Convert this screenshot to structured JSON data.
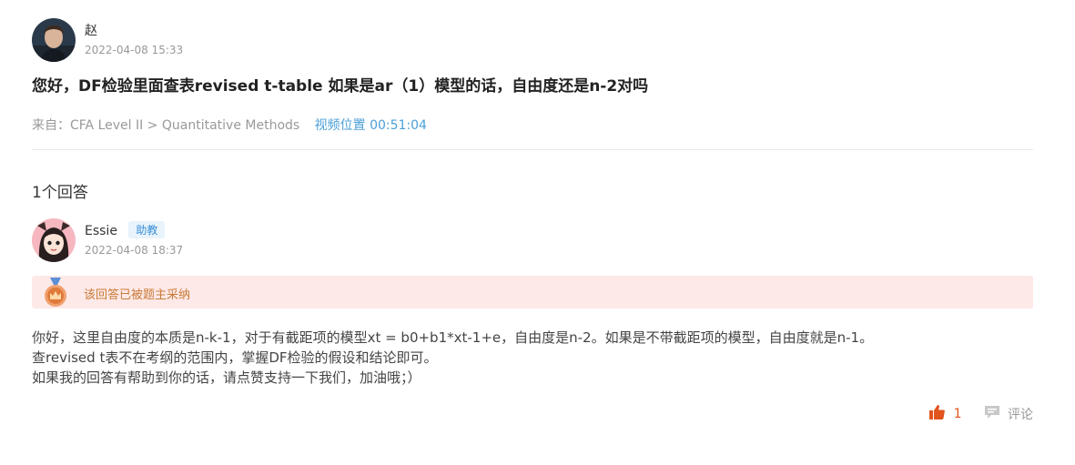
{
  "question": {
    "author_name": "赵",
    "timestamp": "2022-04-08 15:33",
    "title": "您好，DF检验里面查表revised t-table 如果是ar（1）模型的话，自由度还是n-2对吗",
    "source": "来自：CFA Level II > Quantitative Methods",
    "video_position": "视频位置 00:51:04"
  },
  "answers_count": "1个回答",
  "answer": {
    "author_name": "Essie",
    "role_badge": "助教",
    "timestamp": "2022-04-08 18:37",
    "accepted_text": "该回答已被题主采纳",
    "body": [
      "你好，这里自由度的本质是n-k-1，对于有截距项的模型xt = b0+b1*xt-1+e，自由度是n-2。如果是不带截距项的模型，自由度就是n-1。",
      "查revised t表不在考纲的范围内，掌握DF检验的假设和结论即可。",
      "如果我的回答有帮助到你的话，请点赞支持一下我们，加油哦；）"
    ],
    "like_count": "1",
    "comment_label": "评论"
  },
  "colors": {
    "accent_blue": "#4a9fd8",
    "like_orange": "#e2541e",
    "accepted_bg": "#fde9e7",
    "accepted_text": "#c97b39"
  }
}
